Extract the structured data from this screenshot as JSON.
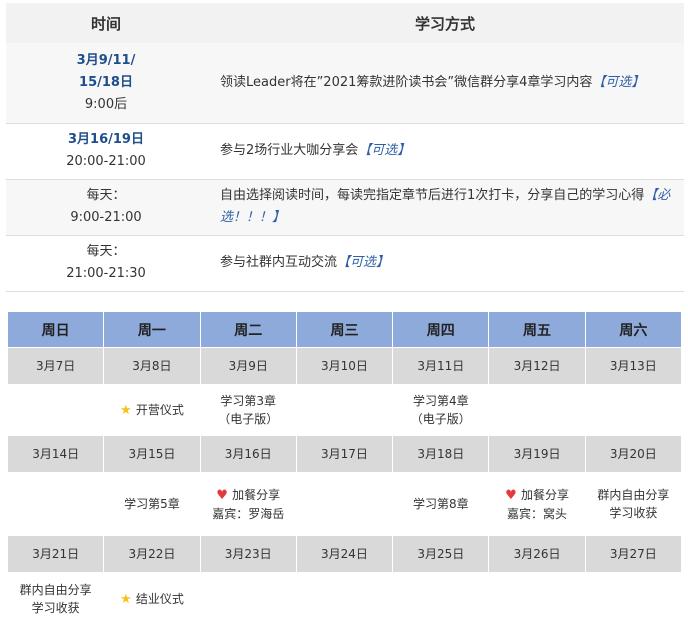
{
  "schedule": {
    "headers": {
      "time": "时间",
      "method": "学习方式"
    },
    "rows": [
      {
        "date": "3月9/11/",
        "date2": "15/18日",
        "time": "9:00后",
        "text": "领读Leader将在”2021筹款进阶读书会”微信群分享4章学习内容",
        "tag": "【可选】"
      },
      {
        "date": "3月16/19日",
        "date2": "",
        "time": "20:00-21:00",
        "text": "参与2场行业大咖分享会",
        "tag": "【可选】"
      },
      {
        "date": "",
        "date2": "每天：",
        "time": "9:00-21:00",
        "text": "自由选择阅读时间，每读完指定章节后进行1次打卡，分享自己的学习心得",
        "tag": "【必选！！！】"
      },
      {
        "date": "",
        "date2": "每天：",
        "time": "21:00-21:30",
        "text": "参与社群内互动交流",
        "tag": "【可选】"
      }
    ]
  },
  "calendar": {
    "weekdays": [
      "周日",
      "周一",
      "周二",
      "周三",
      "周四",
      "周五",
      "周六"
    ],
    "weeks": [
      {
        "dates": [
          "3月7日",
          "3月8日",
          "3月9日",
          "3月10日",
          "3月11日",
          "3月12日",
          "3月13日"
        ],
        "events": [
          {
            "l1": "",
            "l2": ""
          },
          {
            "l1": "开营仪式",
            "l2": "",
            "icon": "star"
          },
          {
            "l1": "学习第3章",
            "l2": "（电子版）"
          },
          {
            "l1": "",
            "l2": ""
          },
          {
            "l1": "学习第4章",
            "l2": "（电子版）"
          },
          {
            "l1": "",
            "l2": ""
          },
          {
            "l1": "",
            "l2": ""
          }
        ]
      },
      {
        "dates": [
          "3月14日",
          "3月15日",
          "3月16日",
          "3月17日",
          "3月18日",
          "3月19日",
          "3月20日"
        ],
        "events": [
          {
            "l1": "",
            "l2": ""
          },
          {
            "l1": "学习第5章",
            "l2": ""
          },
          {
            "l1": "加餐分享",
            "l2": "嘉宾：罗海岳",
            "icon": "heart"
          },
          {
            "l1": "",
            "l2": ""
          },
          {
            "l1": "学习第8章",
            "l2": ""
          },
          {
            "l1": "加餐分享",
            "l2": "嘉宾：窝头",
            "icon": "heart"
          },
          {
            "l1": "群内自由分享",
            "l2": "学习收获"
          }
        ]
      },
      {
        "dates": [
          "3月21日",
          "3月22日",
          "3月23日",
          "3月24日",
          "3月25日",
          "3月26日",
          "3月27日"
        ],
        "events": [
          {
            "l1": "群内自由分享",
            "l2": "学习收获"
          },
          {
            "l1": "结业仪式",
            "l2": "",
            "icon": "star"
          },
          {
            "l1": "",
            "l2": ""
          },
          {
            "l1": "",
            "l2": ""
          },
          {
            "l1": "",
            "l2": ""
          },
          {
            "l1": "",
            "l2": ""
          },
          {
            "l1": "",
            "l2": ""
          }
        ]
      }
    ]
  }
}
